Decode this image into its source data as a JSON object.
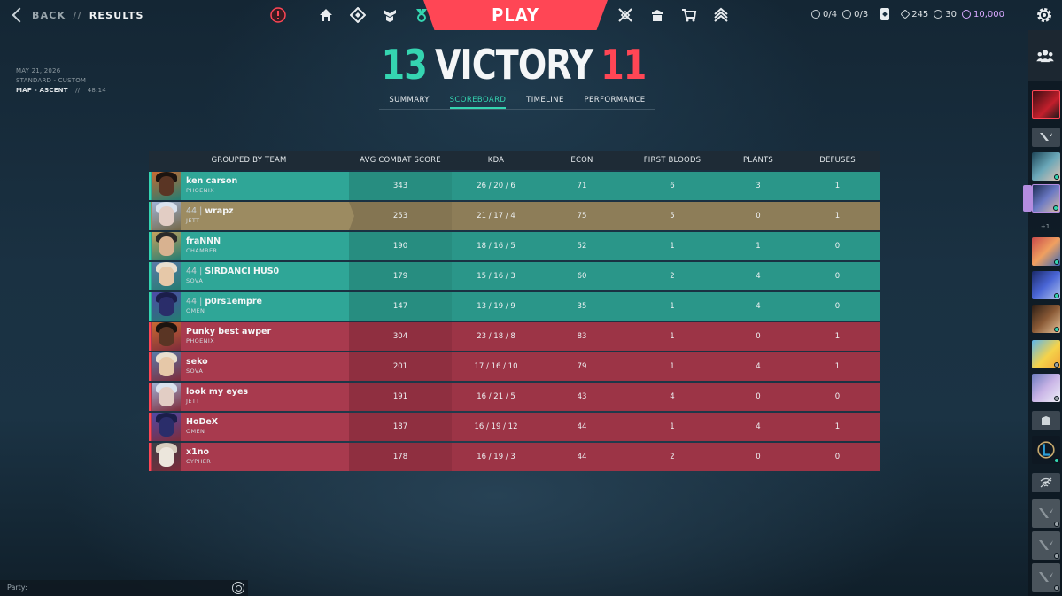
{
  "topbar": {
    "back_label": "BACK",
    "separator": "//",
    "page_label": "RESULTS",
    "play_label": "PLAY",
    "nav_left_icons": [
      "alert-icon",
      "home-icon",
      "agents-icon",
      "career-icon",
      "battlepass-icon"
    ],
    "nav_right_icons": [
      "esports-icon",
      "collection-icon",
      "store-icon",
      "rank-icon"
    ],
    "missions": "0/4",
    "challenges": "0/3",
    "valorant_points": "245",
    "radianite": "30",
    "kingdom_credits": "10,000"
  },
  "match": {
    "date": "MAY 21, 2026",
    "mode": "STANDARD - CUSTOM",
    "map": "MAP - ASCENT",
    "duration_sep": "//",
    "duration": "48:14"
  },
  "result": {
    "score_team": "13",
    "label": "VICTORY",
    "score_enemy": "11"
  },
  "tabs": [
    "SUMMARY",
    "SCOREBOARD",
    "TIMELINE",
    "PERFORMANCE"
  ],
  "active_tab": "SCOREBOARD",
  "scoreboard": {
    "headers": [
      "GROUPED BY TEAM",
      "AVG COMBAT SCORE",
      "KDA",
      "ECON",
      "FIRST BLOODS",
      "PLANTS",
      "DEFUSES"
    ],
    "rows": [
      {
        "level": "",
        "name": "ken carson",
        "agent": "PHOENIX",
        "acs": "343",
        "kda": "26 / 20 / 6",
        "econ": "71",
        "fb": "6",
        "plants": "3",
        "defuses": "1",
        "team": "t1"
      },
      {
        "level": "44 | ",
        "name": "wrapz",
        "agent": "JETT",
        "acs": "253",
        "kda": "21 / 17 / 4",
        "econ": "75",
        "fb": "5",
        "plants": "0",
        "defuses": "1",
        "team": "me"
      },
      {
        "level": "",
        "name": "fraNNN",
        "agent": "CHAMBER",
        "acs": "190",
        "kda": "18 / 16 / 5",
        "econ": "52",
        "fb": "1",
        "plants": "1",
        "defuses": "0",
        "team": "t1"
      },
      {
        "level": "44 | ",
        "name": "SIRDANCI HUS0",
        "agent": "SOVA",
        "acs": "179",
        "kda": "15 / 16 / 3",
        "econ": "60",
        "fb": "2",
        "plants": "4",
        "defuses": "0",
        "team": "t1"
      },
      {
        "level": "44 | ",
        "name": "p0rs1empre",
        "agent": "OMEN",
        "acs": "147",
        "kda": "13 / 19 / 9",
        "econ": "35",
        "fb": "1",
        "plants": "4",
        "defuses": "0",
        "team": "t1"
      },
      {
        "level": "",
        "name": "Punky best awper",
        "agent": "PHOENIX",
        "acs": "304",
        "kda": "23 / 18 / 8",
        "econ": "83",
        "fb": "1",
        "plants": "0",
        "defuses": "1",
        "team": "t2"
      },
      {
        "level": "",
        "name": "seko",
        "agent": "SOVA",
        "acs": "201",
        "kda": "17 / 16 / 10",
        "econ": "79",
        "fb": "1",
        "plants": "4",
        "defuses": "1",
        "team": "t2"
      },
      {
        "level": "",
        "name": "look my eyes",
        "agent": "JETT",
        "acs": "191",
        "kda": "16 / 21 / 5",
        "econ": "43",
        "fb": "4",
        "plants": "0",
        "defuses": "0",
        "team": "t2"
      },
      {
        "level": "",
        "name": "HoDeX",
        "agent": "OMEN",
        "acs": "187",
        "kda": "16 / 19 / 12",
        "econ": "44",
        "fb": "1",
        "plants": "4",
        "defuses": "1",
        "team": "t2"
      },
      {
        "level": "",
        "name": "x1no",
        "agent": "CYPHER",
        "acs": "178",
        "kda": "16 / 19 / 3",
        "econ": "44",
        "fb": "2",
        "plants": "0",
        "defuses": "0",
        "team": "t2"
      }
    ]
  },
  "social": {
    "extra_count": "+1"
  },
  "chat": {
    "label": "Party:"
  },
  "colors": {
    "team_accent": "#35d5b1",
    "enemy_accent": "#ff4655",
    "team_row": "#2a9689",
    "enemy_row": "#9c3446",
    "self_row": "#8d7d58",
    "premium_currency": "#d9a8ff"
  }
}
